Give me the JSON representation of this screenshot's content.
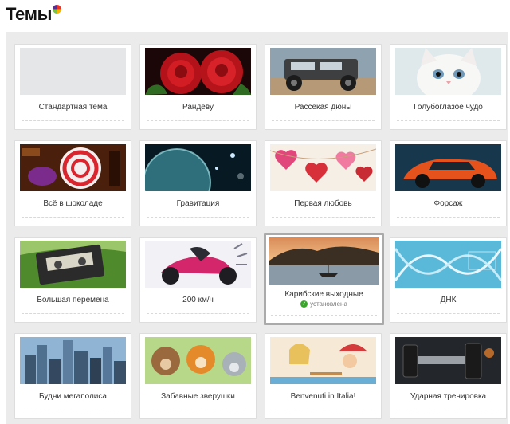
{
  "header": {
    "title": "Темы"
  },
  "themes": [
    {
      "id": "standard",
      "label": "Стандартная тема",
      "icon": "blank-theme-icon",
      "installed": false,
      "status": ""
    },
    {
      "id": "rendezvous",
      "label": "Рандеву",
      "icon": "red-roses-icon",
      "installed": false,
      "status": ""
    },
    {
      "id": "dunes",
      "label": "Рассекая дюны",
      "icon": "offroad-jeep-icon",
      "installed": false,
      "status": ""
    },
    {
      "id": "blue-eyed",
      "label": "Голубоглазое чудо",
      "icon": "white-kitten-icon",
      "installed": false,
      "status": ""
    },
    {
      "id": "chocolate",
      "label": "Всё в шоколаде",
      "icon": "lollipop-candy-icon",
      "installed": false,
      "status": ""
    },
    {
      "id": "gravity",
      "label": "Гравитация",
      "icon": "space-planet-icon",
      "installed": false,
      "status": ""
    },
    {
      "id": "first-love",
      "label": "Первая любовь",
      "icon": "hearts-garland-icon",
      "installed": false,
      "status": ""
    },
    {
      "id": "forsage",
      "label": "Форсаж",
      "icon": "sports-car-icon",
      "installed": false,
      "status": ""
    },
    {
      "id": "big-break",
      "label": "Большая перемена",
      "icon": "cassette-tape-icon",
      "installed": false,
      "status": ""
    },
    {
      "id": "200kmh",
      "label": "200 км/ч",
      "icon": "motorcycle-icon",
      "installed": false,
      "status": ""
    },
    {
      "id": "caribbean",
      "label": "Карибские выходные",
      "icon": "tropical-sunset-icon",
      "installed": true,
      "status": "установлена"
    },
    {
      "id": "dna",
      "label": "ДНК",
      "icon": "dna-helix-icon",
      "installed": false,
      "status": ""
    },
    {
      "id": "megapolis",
      "label": "Будни мегаполиса",
      "icon": "city-skyline-icon",
      "installed": false,
      "status": ""
    },
    {
      "id": "critters",
      "label": "Забавные зверушки",
      "icon": "cartoon-animals-icon",
      "installed": false,
      "status": ""
    },
    {
      "id": "italia",
      "label": "Benvenuti in Italia!",
      "icon": "italian-cafe-icon",
      "installed": false,
      "status": ""
    },
    {
      "id": "workout",
      "label": "Ударная тренировка",
      "icon": "dumbbell-icon",
      "installed": false,
      "status": ""
    }
  ],
  "colors": {
    "grid_background": "#ebebeb",
    "tile_background": "#ffffff",
    "selected_border": "#a9aaa9",
    "installed_check": "#3aa52b"
  }
}
